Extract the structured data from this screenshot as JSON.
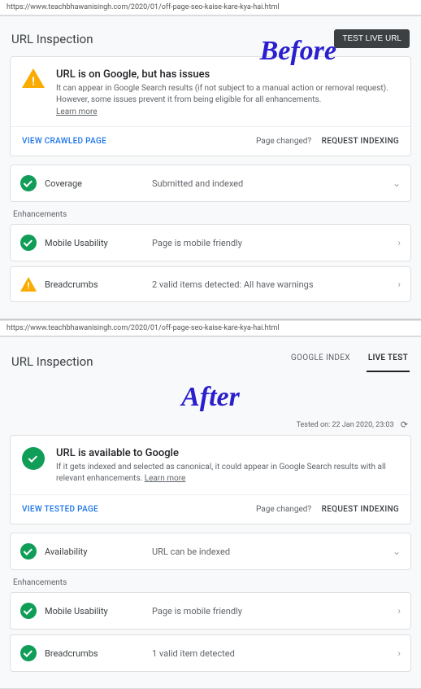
{
  "url": "https://www.teachbhawanisingh.com/2020/01/off-page-seo-kaise-kare-kya-hai.html",
  "hdr_title": "URL Inspection",
  "labels": {
    "before": "Before",
    "after": "After"
  },
  "btn_test_live": "TEST LIVE URL",
  "tabs": {
    "google_index": "GOOGLE INDEX",
    "live_test": "LIVE TEST"
  },
  "before": {
    "status_title": "URL is on Google, but has issues",
    "status_desc": "It can appear in Google Search results (if not subject to a manual action or removal request). However, some issues prevent it from being eligible for all enhancements.",
    "learn_more": "Learn more",
    "view_action": "VIEW CRAWLED PAGE",
    "page_changed": "Page changed?",
    "request_indexing": "REQUEST INDEXING",
    "coverage_label": "Coverage",
    "coverage_status": "Submitted and indexed",
    "enhancements_label": "Enhancements",
    "mob_label": "Mobile Usability",
    "mob_status": "Page is mobile friendly",
    "bc_label": "Breadcrumbs",
    "bc_status": "2 valid items detected: All have warnings"
  },
  "after": {
    "tested_on": "Tested on: 22 Jan 2020, 23:03",
    "status_title": "URL is available to Google",
    "status_desc": "If it gets indexed and selected as canonical, it could appear in Google Search results with all relevant enhancements.",
    "learn_more": "Learn more",
    "view_action": "VIEW TESTED PAGE",
    "page_changed": "Page changed?",
    "request_indexing": "REQUEST INDEXING",
    "avail_label": "Availability",
    "avail_status": "URL can be indexed",
    "enhancements_label": "Enhancements",
    "mob_label": "Mobile Usability",
    "mob_status": "Page is mobile friendly",
    "bc_label": "Breadcrumbs",
    "bc_status": "1 valid item detected"
  }
}
